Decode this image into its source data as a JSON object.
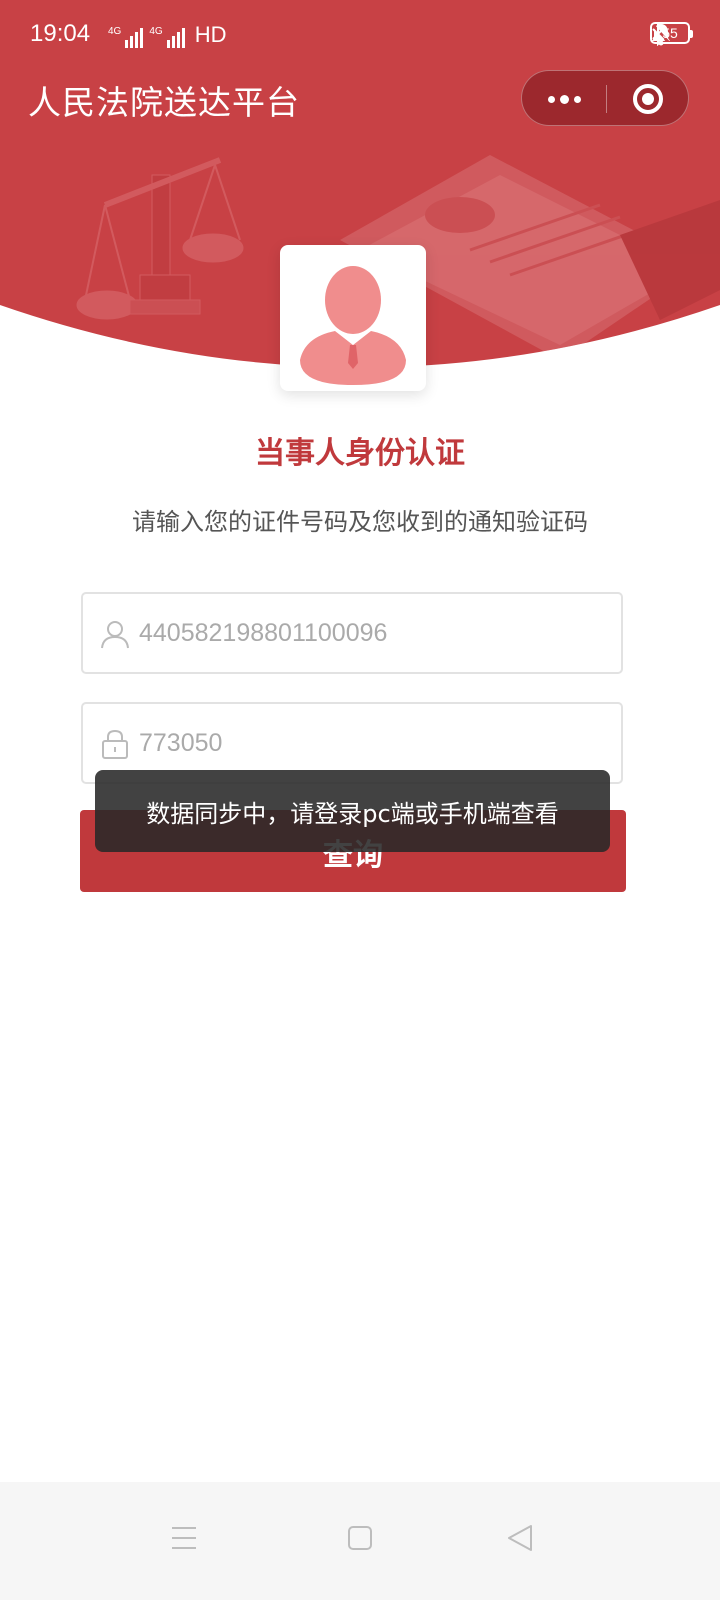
{
  "status_bar": {
    "time": "19:04",
    "network_1": "4G",
    "network_2": "4G",
    "hd": "HD",
    "battery": "55"
  },
  "app": {
    "title": "人民法院送达平台"
  },
  "auth": {
    "title": "当事人身份认证",
    "subtitle": "请输入您的证件号码及您收到的通知验证码",
    "id_value": "440582198801100096",
    "code_value": "773050",
    "submit_label": "查询"
  },
  "toast": {
    "message": "数据同步中，请登录pc端或手机端查看"
  },
  "colors": {
    "brand_red": "#c0393c",
    "header_red": "#c84145",
    "avatar_pink": "#f08d8d"
  },
  "icons": {
    "user_field": "user-icon",
    "code_field": "lock-icon",
    "nav_menu": "menu-icon",
    "nav_home": "home-square-icon",
    "nav_back": "back-triangle-icon"
  }
}
